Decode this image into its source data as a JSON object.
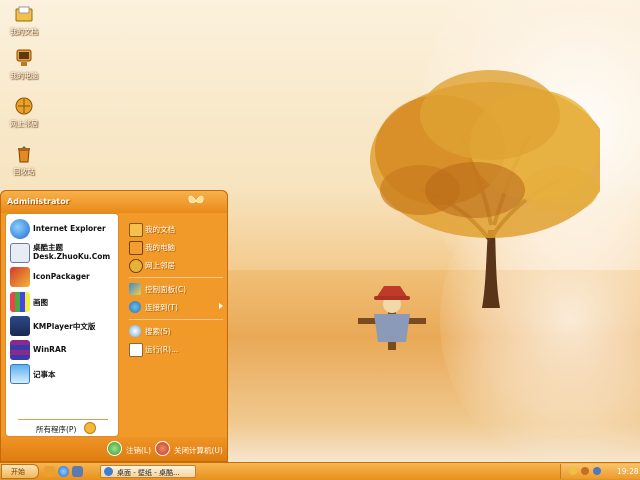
{
  "desktop": {
    "icons": [
      {
        "label": "我的文档",
        "icon": "my-documents-icon"
      },
      {
        "label": "我的电脑",
        "icon": "my-computer-icon"
      },
      {
        "label": "网上邻居",
        "icon": "network-places-icon"
      },
      {
        "label": "回收站",
        "icon": "recycle-bin-icon"
      }
    ]
  },
  "start_menu": {
    "user": "Administrator",
    "pinned": [
      {
        "label": "Internet Explorer",
        "icon": "internet-explorer-icon"
      },
      {
        "label": "桌酷主题",
        "label2": "Desk.ZhuoKu.Com",
        "icon": "zhuoku-theme-icon"
      },
      {
        "label": "IconPackager",
        "icon": "iconpackager-icon"
      },
      {
        "label": "画图",
        "icon": "paint-icon"
      },
      {
        "label": "KMPlayer中文版",
        "icon": "kmplayer-icon"
      },
      {
        "label": "WinRAR",
        "icon": "winrar-icon"
      },
      {
        "label": "记事本",
        "icon": "notepad-icon"
      }
    ],
    "all_programs": "所有程序(P)",
    "places": [
      {
        "label": "我的文档",
        "icon": "my-documents-icon"
      },
      {
        "label": "我的电脑",
        "icon": "my-computer-icon"
      },
      {
        "label": "网上邻居",
        "icon": "network-places-icon"
      },
      {
        "label": "控制面板(C)",
        "icon": "control-panel-icon"
      },
      {
        "label": "连接到(T)",
        "icon": "connect-to-icon"
      },
      {
        "label": "搜索(S)",
        "icon": "search-icon"
      },
      {
        "label": "运行(R)...",
        "icon": "run-icon"
      }
    ],
    "logoff": "注销(L)",
    "shutdown": "关闭计算机(U)"
  },
  "taskbar": {
    "start_label": "开始",
    "window_title": "桌面 - 壁纸 - 桌酷...",
    "clock": "19:28"
  },
  "colors": {
    "accent": "#f19a2a",
    "taskbar": "#e8901c"
  }
}
